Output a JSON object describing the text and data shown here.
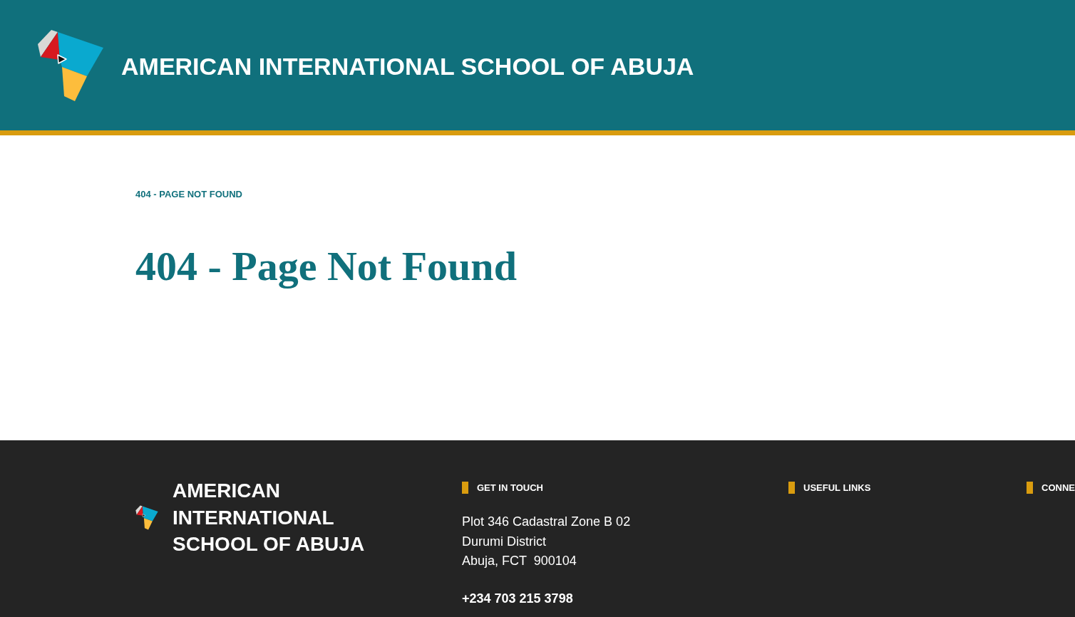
{
  "header": {
    "title": "AMERICAN INTERNATIONAL SCHOOL OF ABUJA"
  },
  "breadcrumb": "404 - PAGE NOT FOUND",
  "page_title": "404 - Page Not Found",
  "footer": {
    "school_name": "AMERICAN INTERNATIONAL SCHOOL OF ABUJA",
    "columns": [
      {
        "heading": "GET IN TOUCH",
        "address_lines": [
          "Plot 346 Cadastral Zone B 02",
          "Durumi District",
          "Abuja, FCT  900104"
        ],
        "phone": "+234 703 215 3798"
      },
      {
        "heading": "USEFUL LINKS"
      },
      {
        "heading": "CONNE"
      }
    ]
  }
}
